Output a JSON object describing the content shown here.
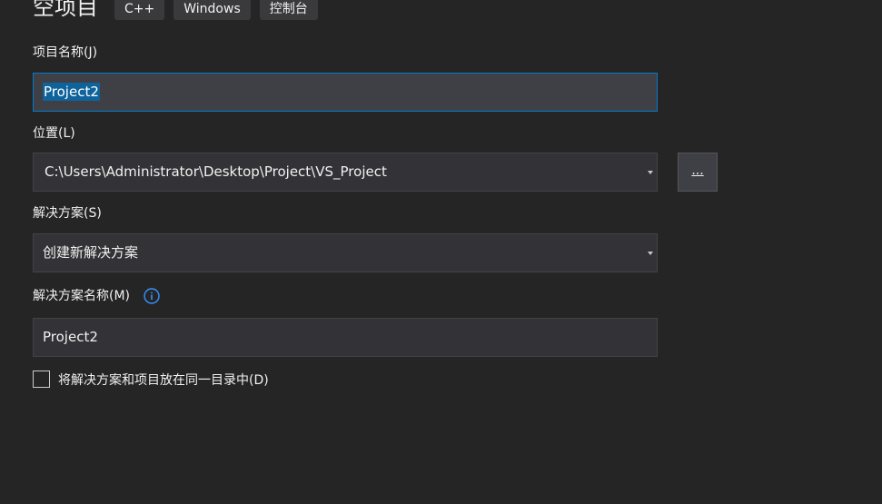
{
  "header": {
    "title": "空项目",
    "tags": [
      "C++",
      "Windows",
      "控制台"
    ]
  },
  "project_name": {
    "label": "项目名称(J)",
    "value": "Project2"
  },
  "location": {
    "label": "位置(L)",
    "value": "C:\\Users\\Administrator\\Desktop\\Project\\VS_Project",
    "browse_label": "..."
  },
  "solution": {
    "label": "解决方案(S)",
    "value": "创建新解决方案"
  },
  "solution_name": {
    "label": "解决方案名称(M)",
    "value": "Project2",
    "info_icon": "info-icon"
  },
  "same_dir": {
    "label": "将解决方案和项目放在同一目录中(D)",
    "checked": false
  },
  "colors": {
    "background": "#252526",
    "field_background": "#333337",
    "focus_border": "#007acc",
    "selection": "#0e639c",
    "info_accent": "#3794ff"
  }
}
